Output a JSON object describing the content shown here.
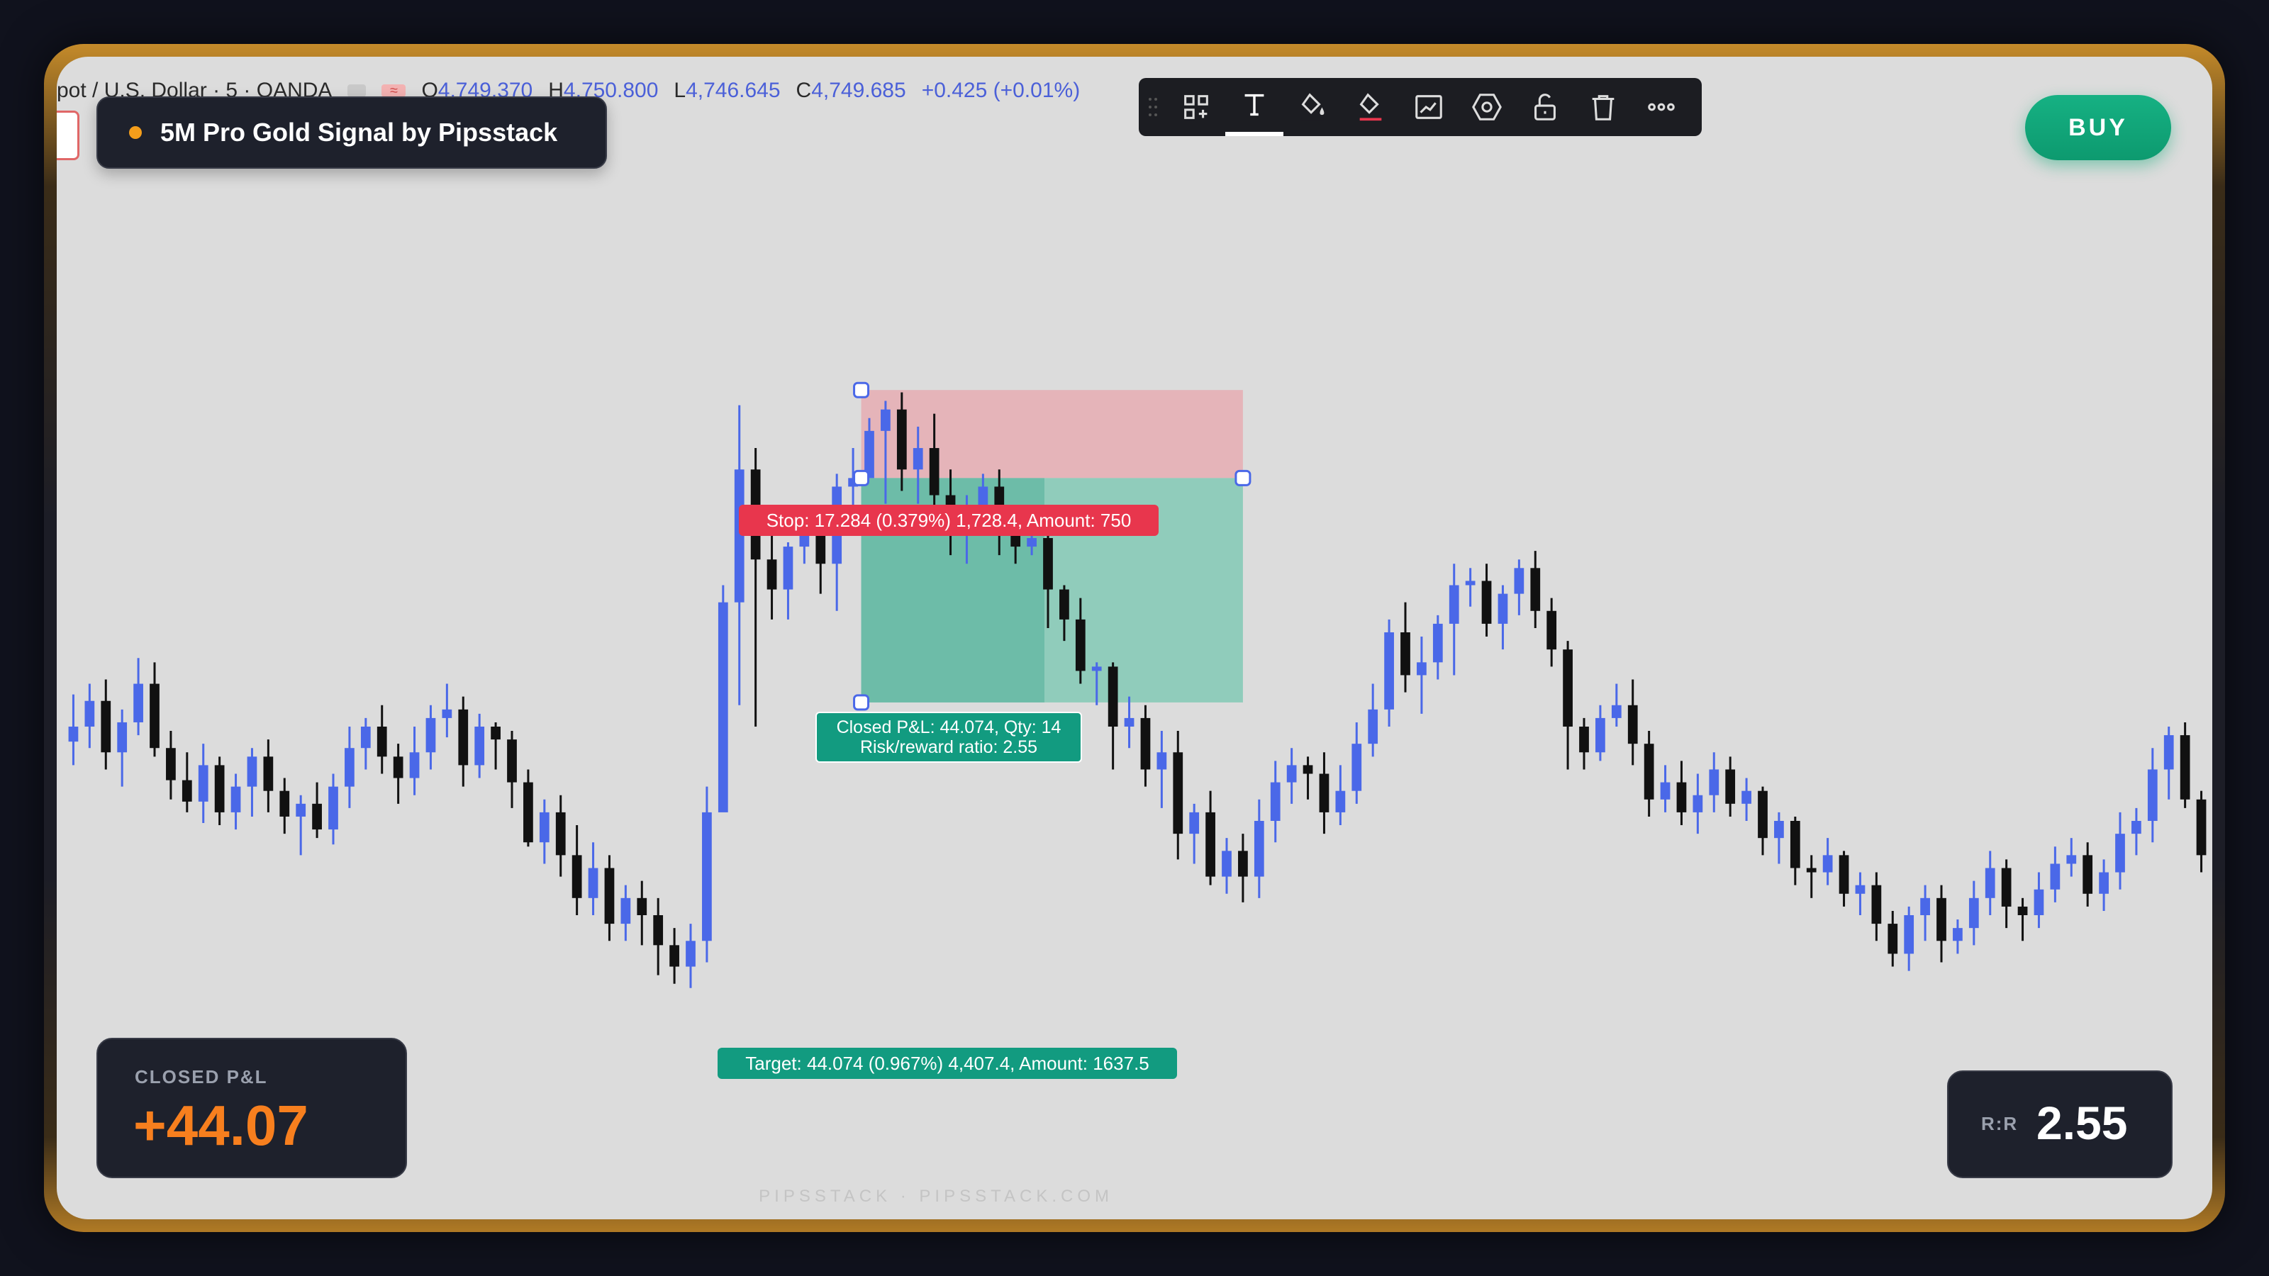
{
  "header": {
    "symbol": "pot / U.S. Dollar · 5 · OANDA",
    "badge": "≈",
    "open_key": "O",
    "open": "4,749.370",
    "high_key": "H",
    "high": "4,750.800",
    "low_key": "L",
    "low": "4,746.645",
    "close_key": "C",
    "close": "4,749.685",
    "change": "+0.425 (+0.01%)"
  },
  "signal": {
    "title": "5M Pro Gold Signal by Pipsstack",
    "dot_color": "#f59e1b"
  },
  "buy_button": {
    "label": "BUY",
    "color": "#10a97a"
  },
  "toolbar": {
    "icons": [
      "grip-icon",
      "template-icon",
      "text-icon",
      "fill-color-icon",
      "line-color-icon",
      "chart-style-icon",
      "settings-icon",
      "lock-icon",
      "trash-icon",
      "more-icon"
    ]
  },
  "position": {
    "stop_label": "Stop: 17.284 (0.379%) 1,728.4, Amount: 750",
    "target_label": "Target: 44.074 (0.967%) 4,407.4, Amount: 1637.5",
    "pnl_line1": "Closed P&L: 44.074, Qty: 14",
    "pnl_line2": "Risk/reward ratio: 2.55",
    "stop_color": "#e8364d",
    "target_color": "#129b80"
  },
  "pnl_card": {
    "title": "CLOSED P&L",
    "value": "+44.07",
    "value_color": "#f77f1e"
  },
  "rr_card": {
    "title": "R:R",
    "value": "2.55"
  },
  "watermark": "PIPSSTACK · PIPSSTACK.COM",
  "colors": {
    "bull": "#4a68e8",
    "bear": "#111111",
    "background": "#dcdcdc"
  },
  "chart_data": {
    "type": "candlestick",
    "candles": [
      [
        633,
        640,
        622,
        655
      ],
      [
        640,
        652,
        630,
        660
      ],
      [
        652,
        628,
        620,
        662
      ],
      [
        628,
        642,
        612,
        648
      ],
      [
        642,
        660,
        636,
        672
      ],
      [
        660,
        630,
        626,
        670
      ],
      [
        630,
        615,
        606,
        638
      ],
      [
        615,
        605,
        600,
        628
      ],
      [
        605,
        622,
        595,
        632
      ],
      [
        622,
        600,
        594,
        626
      ],
      [
        600,
        612,
        592,
        618
      ],
      [
        612,
        626,
        598,
        630
      ],
      [
        626,
        610,
        600,
        634
      ],
      [
        610,
        598,
        590,
        616
      ],
      [
        598,
        604,
        580,
        608
      ],
      [
        604,
        592,
        588,
        614
      ],
      [
        592,
        612,
        585,
        618
      ],
      [
        612,
        630,
        602,
        640
      ],
      [
        630,
        640,
        620,
        644
      ],
      [
        640,
        626,
        618,
        650
      ],
      [
        626,
        616,
        604,
        632
      ],
      [
        616,
        628,
        608,
        640
      ],
      [
        628,
        644,
        620,
        650
      ],
      [
        644,
        648,
        635,
        660
      ],
      [
        648,
        622,
        612,
        654
      ],
      [
        622,
        640,
        616,
        646
      ],
      [
        640,
        634,
        620,
        642
      ],
      [
        634,
        614,
        602,
        638
      ],
      [
        614,
        586,
        584,
        620
      ],
      [
        586,
        600,
        576,
        606
      ],
      [
        600,
        580,
        570,
        608
      ],
      [
        580,
        560,
        552,
        594
      ],
      [
        560,
        574,
        552,
        586
      ],
      [
        574,
        548,
        540,
        580
      ],
      [
        548,
        560,
        540,
        566
      ],
      [
        560,
        552,
        538,
        568
      ],
      [
        552,
        538,
        524,
        560
      ],
      [
        538,
        528,
        520,
        546
      ],
      [
        528,
        540,
        518,
        548
      ],
      [
        540,
        600,
        530,
        612
      ],
      [
        600,
        698,
        640,
        706
      ],
      [
        698,
        760,
        650,
        790
      ],
      [
        760,
        718,
        640,
        770
      ],
      [
        718,
        704,
        690,
        738
      ],
      [
        704,
        724,
        690,
        726
      ],
      [
        724,
        734,
        716,
        742
      ],
      [
        734,
        716,
        702,
        742
      ],
      [
        716,
        752,
        694,
        758
      ],
      [
        752,
        756,
        742,
        770
      ],
      [
        756,
        778,
        760,
        784
      ],
      [
        778,
        788,
        744,
        792
      ],
      [
        788,
        760,
        750,
        796
      ],
      [
        760,
        770,
        744,
        780
      ],
      [
        770,
        748,
        738,
        786
      ],
      [
        748,
        732,
        720,
        760
      ],
      [
        732,
        742,
        716,
        748
      ],
      [
        742,
        752,
        730,
        758
      ],
      [
        752,
        730,
        720,
        760
      ],
      [
        730,
        724,
        716,
        738
      ],
      [
        724,
        728,
        720,
        734
      ],
      [
        728,
        704,
        686,
        742
      ],
      [
        704,
        690,
        680,
        706
      ],
      [
        690,
        666,
        660,
        700
      ],
      [
        666,
        668,
        650,
        670
      ],
      [
        668,
        640,
        620,
        670
      ],
      [
        640,
        644,
        630,
        654
      ],
      [
        644,
        620,
        612,
        650
      ],
      [
        620,
        628,
        602,
        638
      ],
      [
        628,
        590,
        578,
        638
      ],
      [
        590,
        600,
        576,
        604
      ],
      [
        600,
        570,
        566,
        610
      ],
      [
        570,
        582,
        562,
        588
      ],
      [
        582,
        570,
        558,
        590
      ],
      [
        570,
        596,
        560,
        606
      ],
      [
        596,
        614,
        586,
        624
      ],
      [
        614,
        622,
        604,
        630
      ],
      [
        622,
        618,
        606,
        626
      ],
      [
        618,
        600,
        590,
        628
      ],
      [
        600,
        610,
        594,
        622
      ],
      [
        610,
        632,
        604,
        642
      ],
      [
        632,
        648,
        626,
        660
      ],
      [
        648,
        684,
        640,
        690
      ],
      [
        684,
        664,
        656,
        698
      ],
      [
        664,
        670,
        646,
        682
      ],
      [
        670,
        688,
        662,
        692
      ],
      [
        688,
        706,
        664,
        716
      ],
      [
        706,
        708,
        696,
        714
      ],
      [
        708,
        688,
        682,
        716
      ],
      [
        688,
        702,
        676,
        706
      ],
      [
        702,
        714,
        692,
        718
      ],
      [
        714,
        694,
        686,
        722
      ],
      [
        694,
        676,
        668,
        700
      ],
      [
        676,
        640,
        620,
        680
      ],
      [
        640,
        628,
        620,
        644
      ],
      [
        628,
        644,
        624,
        650
      ],
      [
        644,
        650,
        640,
        660
      ],
      [
        650,
        632,
        622,
        662
      ],
      [
        632,
        606,
        598,
        638
      ],
      [
        606,
        614,
        600,
        622
      ],
      [
        614,
        600,
        594,
        624
      ],
      [
        600,
        608,
        590,
        618
      ],
      [
        608,
        620,
        600,
        628
      ],
      [
        620,
        604,
        598,
        626
      ],
      [
        604,
        610,
        596,
        616
      ],
      [
        610,
        588,
        580,
        612
      ],
      [
        588,
        596,
        576,
        600
      ],
      [
        596,
        574,
        566,
        598
      ],
      [
        574,
        572,
        560,
        580
      ],
      [
        572,
        580,
        566,
        588
      ],
      [
        580,
        562,
        556,
        582
      ],
      [
        562,
        566,
        552,
        572
      ],
      [
        566,
        548,
        540,
        572
      ],
      [
        548,
        534,
        528,
        554
      ],
      [
        534,
        552,
        526,
        556
      ],
      [
        552,
        560,
        540,
        566
      ],
      [
        560,
        540,
        530,
        566
      ],
      [
        540,
        546,
        534,
        550
      ],
      [
        546,
        560,
        538,
        568
      ],
      [
        560,
        574,
        552,
        582
      ],
      [
        574,
        556,
        546,
        578
      ],
      [
        556,
        552,
        540,
        560
      ],
      [
        552,
        564,
        546,
        572
      ],
      [
        564,
        576,
        558,
        584
      ],
      [
        576,
        580,
        570,
        588
      ],
      [
        580,
        562,
        556,
        586
      ],
      [
        562,
        572,
        554,
        578
      ],
      [
        572,
        590,
        564,
        600
      ],
      [
        590,
        596,
        580,
        602
      ],
      [
        596,
        620,
        586,
        630
      ],
      [
        620,
        636,
        606,
        640
      ],
      [
        636,
        606,
        602,
        642
      ],
      [
        606,
        580,
        572,
        610
      ]
    ],
    "position_tool": {
      "entry_candle_index": 49,
      "exit_candle_index": 72,
      "target_offset": 44.074,
      "stop_offset": 17.284,
      "quantity": 14,
      "risk_reward": 2.55
    },
    "grid": false
  }
}
